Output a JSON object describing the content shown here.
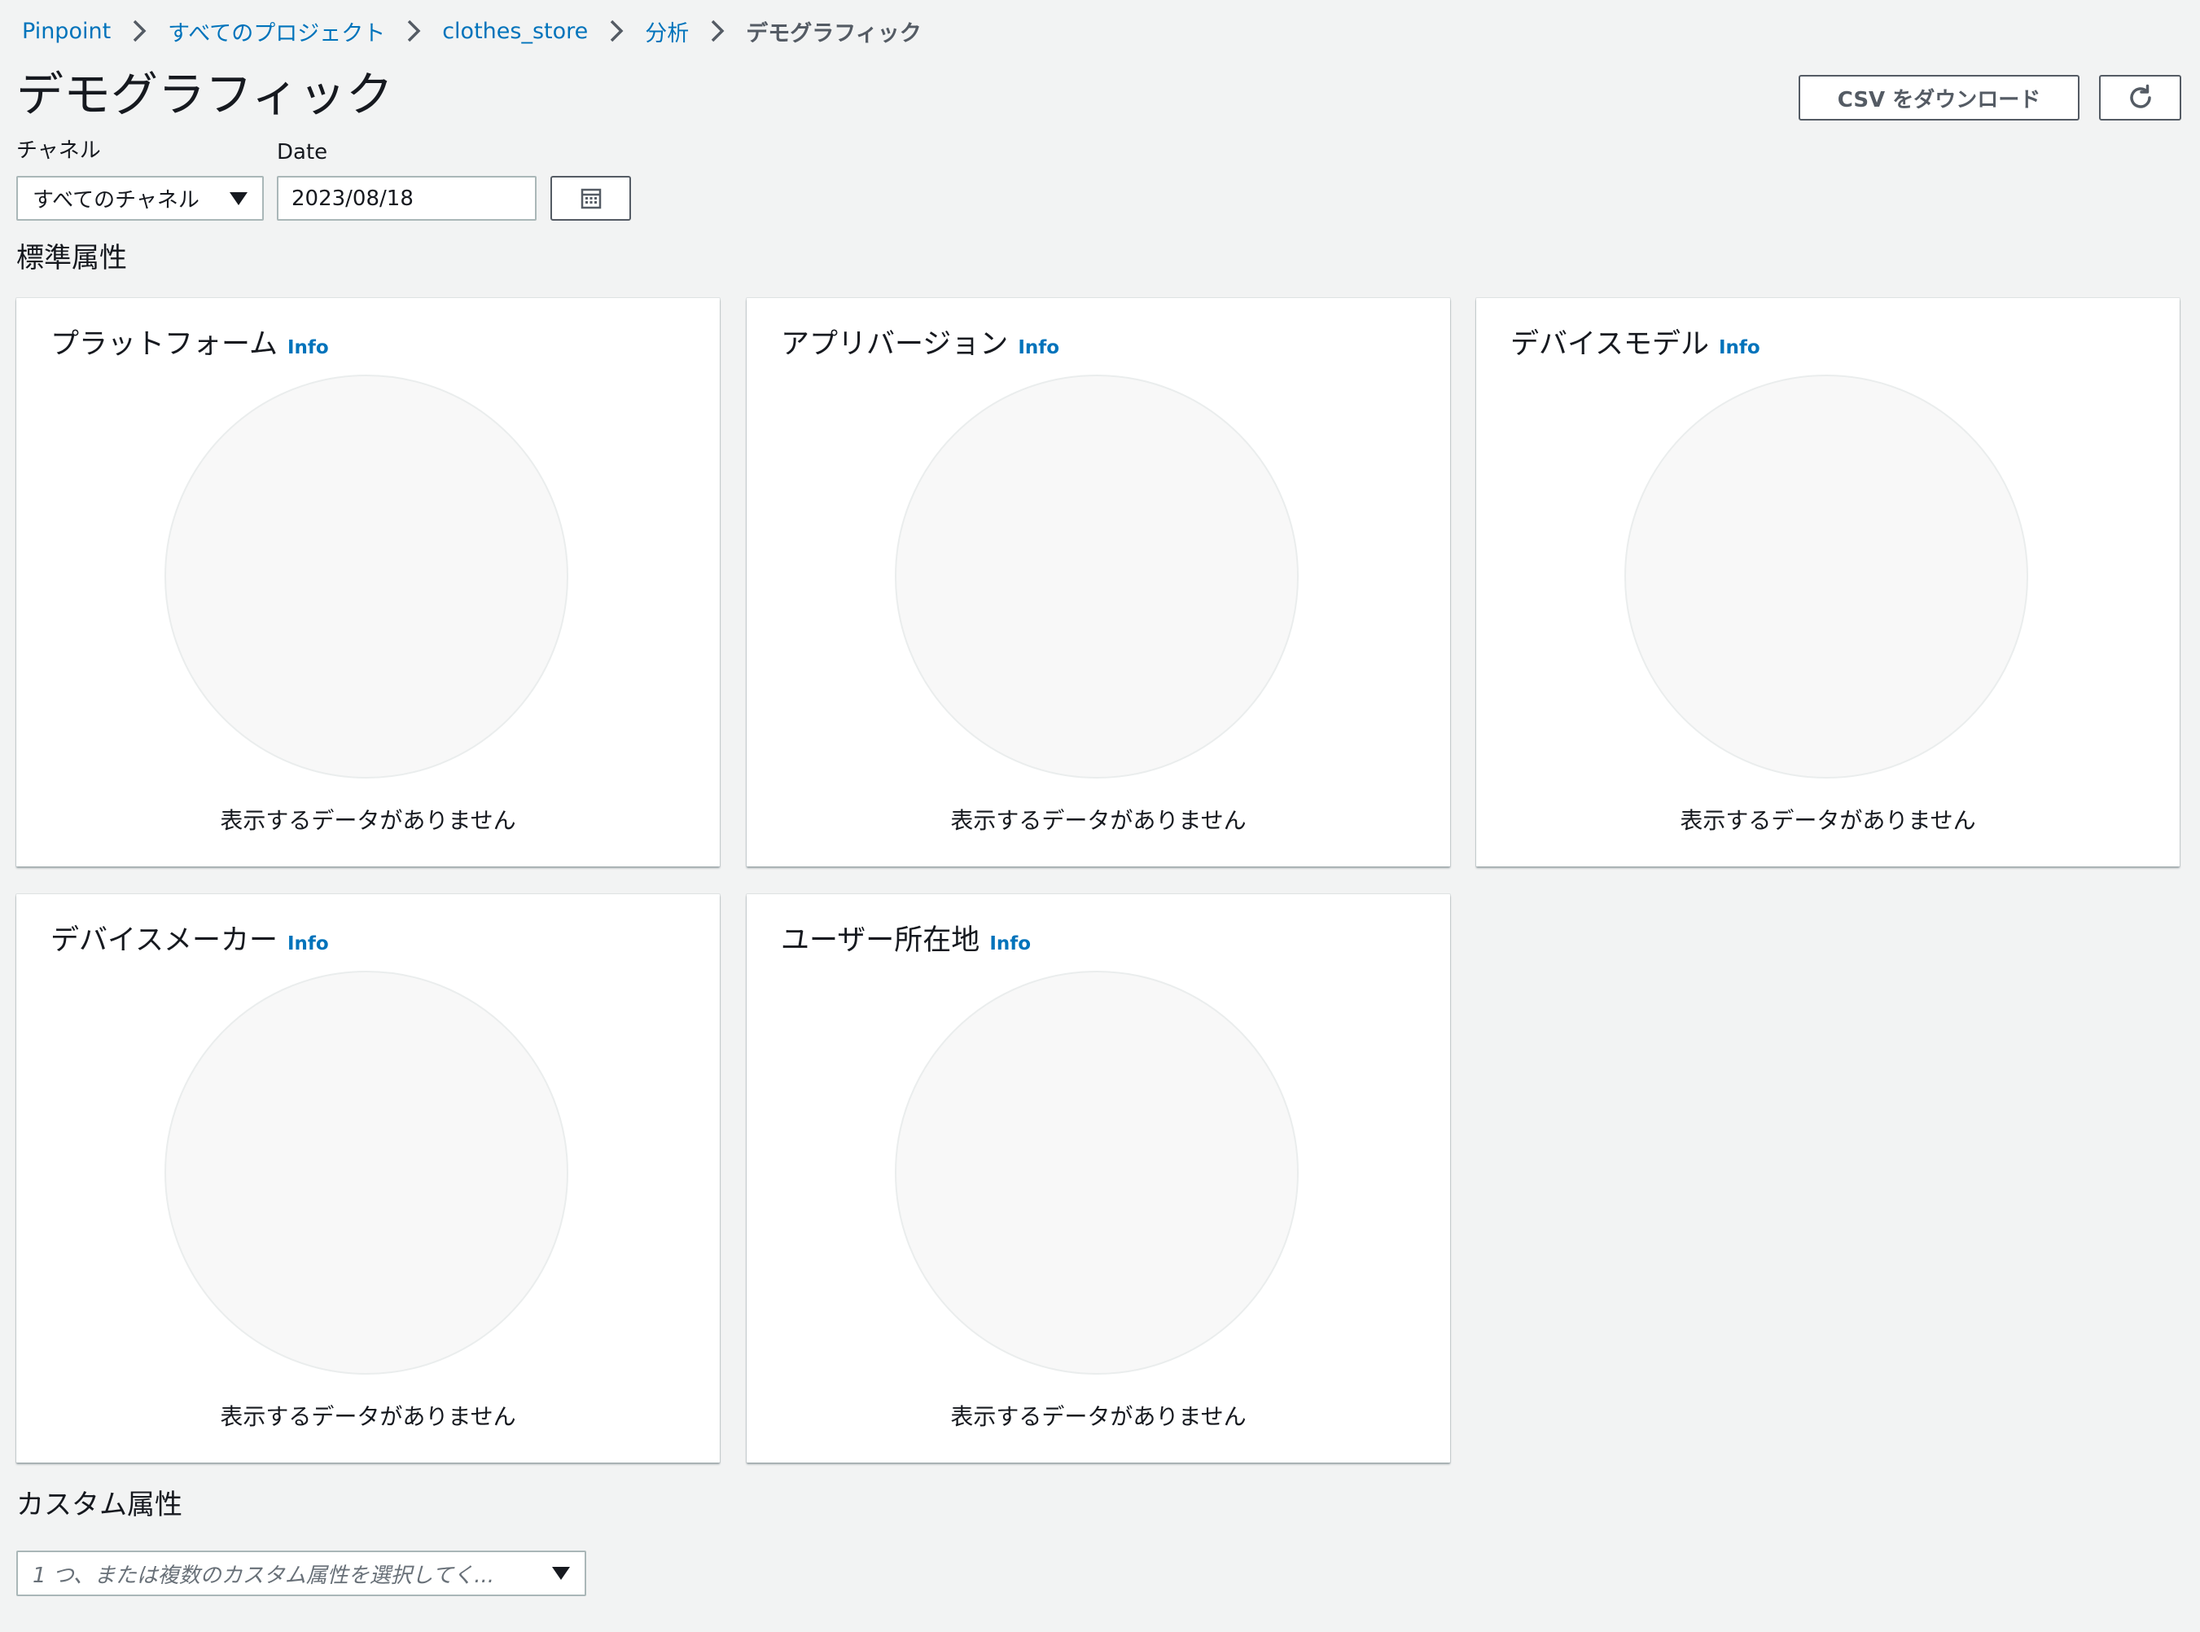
{
  "breadcrumb": {
    "items": [
      "Pinpoint",
      "すべてのプロジェクト",
      "clothes_store",
      "分析"
    ],
    "current": "デモグラフィック"
  },
  "page": {
    "title": "デモグラフィック"
  },
  "actions": {
    "download_csv_label": "CSV をダウンロード",
    "refresh_icon": "refresh-icon"
  },
  "filters": {
    "channel_label": "チャネル",
    "channel_value": "すべてのチャネル",
    "date_label": "Date",
    "date_value": "2023/08/18",
    "calendar_icon": "calendar-icon"
  },
  "standard_attributes": {
    "title": "標準属性",
    "cards": [
      {
        "title": "プラットフォーム",
        "info": "Info",
        "empty_text": "表示するデータがありません"
      },
      {
        "title": "アプリバージョン",
        "info": "Info",
        "empty_text": "表示するデータがありません"
      },
      {
        "title": "デバイスモデル",
        "info": "Info",
        "empty_text": "表示するデータがありません"
      },
      {
        "title": "デバイスメーカー",
        "info": "Info",
        "empty_text": "表示するデータがありません"
      },
      {
        "title": "ユーザー所在地",
        "info": "Info",
        "empty_text": "表示するデータがありません"
      }
    ]
  },
  "custom_attributes": {
    "title": "カスタム属性",
    "select_placeholder": "1 つ、または複数のカスタム属性を選択してく..."
  },
  "colors": {
    "background": "#f2f3f3",
    "link": "#0073bb",
    "text": "#16191f",
    "empty_pie_fill": "#f8f8f8",
    "empty_pie_border": "#eaeded"
  }
}
